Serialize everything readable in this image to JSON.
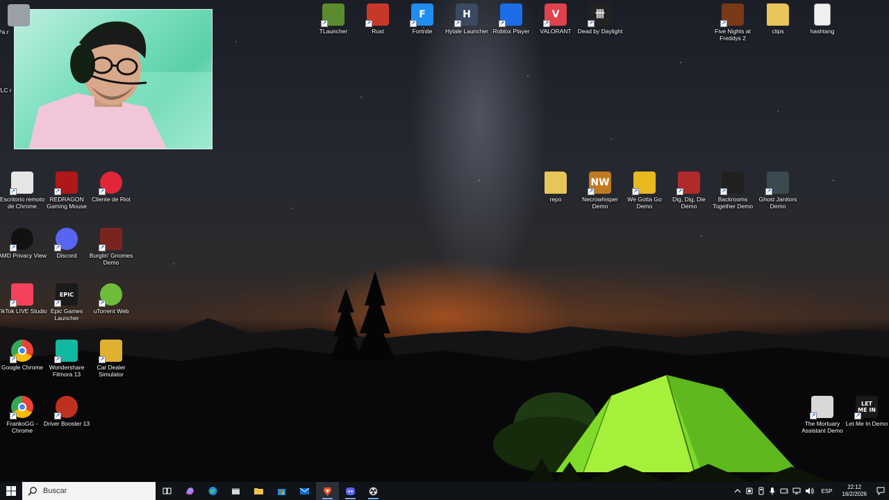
{
  "desktop": {
    "top_row": [
      {
        "label": "TLauncher",
        "icon": "minecraft-grass-block-icon",
        "color": "#5c8a2e"
      },
      {
        "label": "Rust",
        "icon": "rust-game-icon",
        "color": "#c8382a"
      },
      {
        "label": "Fortnite",
        "icon": "fortnite-icon",
        "color": "#1f8ef0",
        "glyph": "F"
      },
      {
        "label": "Hytale Launcher",
        "icon": "hytale-icon",
        "color": "#3a4a60",
        "glyph": "H"
      },
      {
        "label": "Roblox Player",
        "icon": "roblox-icon",
        "color": "#1e6de8"
      },
      {
        "label": "VALORANT",
        "icon": "valorant-icon",
        "color": "#e0424d",
        "glyph": "V"
      },
      {
        "label": "Dead by Daylight",
        "icon": "dead-by-daylight-icon",
        "color": "#222",
        "glyph": "卌"
      },
      {
        "label": "Five Nights at Freddys 2",
        "icon": "fnaf-freddy-icon",
        "color": "#7a3a18"
      },
      {
        "label": "clips",
        "icon": "folder-icon",
        "color": "#e8c558"
      },
      {
        "label": "hashtang",
        "icon": "text-file-icon",
        "color": "#f0f0f0"
      }
    ],
    "left_partial": [
      {
        "label": "Pa r"
      },
      {
        "label": "VLC r"
      }
    ],
    "left_grid": [
      [
        {
          "label": "Escritorio remoto de Chrome",
          "icon": "chrome-remote-desktop-icon",
          "color": "#e6e6e6"
        },
        {
          "label": "REDRAGON Gaming Mouse",
          "icon": "redragon-dragon-icon",
          "color": "#b01818"
        },
        {
          "label": "Cliente de Riot",
          "icon": "riot-client-icon",
          "color": "#e2263a"
        }
      ],
      [
        {
          "label": "AMD Privacy View",
          "icon": "amd-eye-icon",
          "color": "#111"
        },
        {
          "label": "Discord",
          "icon": "discord-icon",
          "color": "#5865f2"
        },
        {
          "label": "Burglin' Gnomes Demo",
          "icon": "burglin-gnomes-icon",
          "color": "#7a2420"
        }
      ],
      [
        {
          "label": "TikTok LIVE Studio",
          "icon": "tiktok-live-icon",
          "color": "#f5415c"
        },
        {
          "label": "Epic Games Launcher",
          "icon": "epic-games-icon",
          "color": "#1a1a1a",
          "glyph": "EPIC"
        },
        {
          "label": "uTorrent Web",
          "icon": "utorrent-icon",
          "color": "#6dbd3a"
        }
      ],
      [
        {
          "label": "Google Chrome",
          "icon": "chrome-icon",
          "color": "#4285f4"
        },
        {
          "label": "Wondershare Filmora 13",
          "icon": "filmora-icon",
          "color": "#10b8a0"
        },
        {
          "label": "Car Dealer Simulator",
          "icon": "car-dealer-simulator-icon",
          "color": "#e0b030"
        }
      ],
      [
        {
          "label": "FrankoGG - Chrome",
          "icon": "chrome-profile-icon",
          "color": "#4285f4"
        },
        {
          "label": "Driver Booster 13",
          "icon": "driver-booster-icon",
          "color": "#c0301e"
        }
      ]
    ],
    "right_row": [
      {
        "label": "repo",
        "icon": "folder-icon",
        "color": "#e8c558"
      },
      {
        "label": "Necrowhisper Demo",
        "icon": "necrowhisper-icon",
        "color": "#c07a20",
        "glyph": "NW"
      },
      {
        "label": "We Gotta Go Demo",
        "icon": "we-gotta-go-icon",
        "color": "#e8b820"
      },
      {
        "label": "Dig, Dig, Die Demo",
        "icon": "dig-dig-die-icon",
        "color": "#b02a2a"
      },
      {
        "label": "Backrooms Together Demo",
        "icon": "backrooms-together-icon",
        "color": "#202020"
      },
      {
        "label": "Ghost Janitors Demo",
        "icon": "ghost-janitors-icon",
        "color": "#3a4a50"
      }
    ],
    "bottom_right": [
      {
        "label": "The Mortuary Assistant Demo",
        "icon": "mortuary-assistant-icon",
        "color": "#d8d8d8"
      },
      {
        "label": "Let Me In Demo",
        "icon": "let-me-in-icon",
        "color": "#1a1a1a",
        "glyph": "LET ME IN"
      }
    ]
  },
  "taskbar": {
    "search_placeholder": "Buscar",
    "pinned": [
      {
        "icon": "task-view-icon"
      },
      {
        "icon": "copilot-icon"
      },
      {
        "icon": "edge-icon"
      },
      {
        "icon": "file-explorer-icon"
      },
      {
        "icon": "folder-icon"
      },
      {
        "icon": "microsoft-store-icon"
      },
      {
        "icon": "mail-icon"
      },
      {
        "icon": "brave-icon",
        "active": true
      },
      {
        "icon": "discord-icon",
        "open": true
      },
      {
        "icon": "obs-icon",
        "open": true
      }
    ],
    "tray": {
      "language": "ESP",
      "time": "22:12",
      "date": "16/2/2026"
    }
  }
}
